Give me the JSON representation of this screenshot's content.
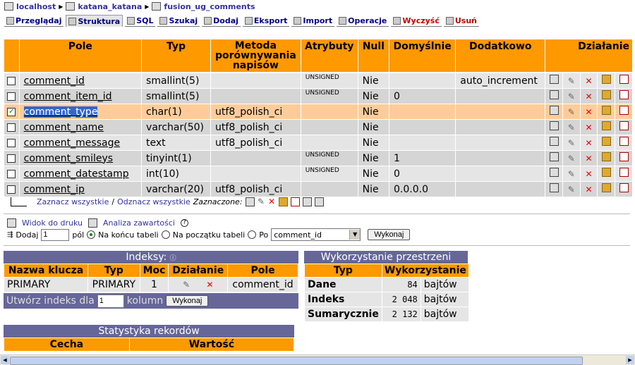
{
  "breadcrumb": {
    "server": "localhost",
    "database": "katana_katana",
    "table": "fusion_ug_comments"
  },
  "tabs": [
    {
      "label": "Przeglądaj",
      "icon": "browse-icon",
      "active": false
    },
    {
      "label": "Struktura",
      "icon": "structure-icon",
      "active": true
    },
    {
      "label": "SQL",
      "icon": "sql-icon",
      "active": false
    },
    {
      "label": "Szukaj",
      "icon": "search-icon",
      "active": false
    },
    {
      "label": "Dodaj",
      "icon": "insert-icon",
      "active": false
    },
    {
      "label": "Eksport",
      "icon": "export-icon",
      "active": false
    },
    {
      "label": "Import",
      "icon": "import-icon",
      "active": false
    },
    {
      "label": "Operacje",
      "icon": "operations-icon",
      "active": false
    },
    {
      "label": "Wyczyść",
      "icon": "empty-icon",
      "active": false
    },
    {
      "label": "Usuń",
      "icon": "drop-icon",
      "active": false
    }
  ],
  "structure": {
    "headers": {
      "pole": "Pole",
      "typ": "Typ",
      "metoda": "Metoda porównywania napisów",
      "atrybuty": "Atrybuty",
      "null": "Null",
      "domyslnie": "Domyślnie",
      "dodatkowo": "Dodatkowo",
      "dzialanie": "Działanie"
    },
    "rows": [
      {
        "name": "comment_id",
        "type": "smallint(5)",
        "collation": "",
        "attributes": "UNSIGNED",
        "null": "Nie",
        "default": "",
        "extra": "auto_increment",
        "checked": false
      },
      {
        "name": "comment_item_id",
        "type": "smallint(5)",
        "collation": "",
        "attributes": "UNSIGNED",
        "null": "Nie",
        "default": "0",
        "extra": "",
        "checked": false
      },
      {
        "name": "comment_type",
        "type": "char(1)",
        "collation": "utf8_polish_ci",
        "attributes": "",
        "null": "Nie",
        "default": "",
        "extra": "",
        "checked": true
      },
      {
        "name": "comment_name",
        "type": "varchar(50)",
        "collation": "utf8_polish_ci",
        "attributes": "",
        "null": "Nie",
        "default": "",
        "extra": "",
        "checked": false
      },
      {
        "name": "comment_message",
        "type": "text",
        "collation": "utf8_polish_ci",
        "attributes": "",
        "null": "Nie",
        "default": "",
        "extra": "",
        "checked": false
      },
      {
        "name": "comment_smileys",
        "type": "tinyint(1)",
        "collation": "",
        "attributes": "UNSIGNED",
        "null": "Nie",
        "default": "1",
        "extra": "",
        "checked": false
      },
      {
        "name": "comment_datestamp",
        "type": "int(10)",
        "collation": "",
        "attributes": "UNSIGNED",
        "null": "Nie",
        "default": "0",
        "extra": "",
        "checked": false
      },
      {
        "name": "comment_ip",
        "type": "varchar(20)",
        "collation": "utf8_polish_ci",
        "attributes": "",
        "null": "Nie",
        "default": "0.0.0.0",
        "extra": "",
        "checked": false
      }
    ]
  },
  "selection": {
    "check_all": "Zaznacz wszystkie",
    "slash": "/",
    "uncheck_all": "Odznacz wszystkie",
    "with_selected": "Zaznaczone:"
  },
  "links": {
    "print_view": "Widok do druku",
    "analyze": "Analiza zawartości"
  },
  "add_fields": {
    "label": "Dodaj",
    "count": "1",
    "fields": "pól",
    "at_end": "Na końcu tabeli",
    "at_beginning": "Na początku tabeli",
    "after": "Po",
    "after_field": "comment_id",
    "go": "Wykonaj"
  },
  "indexes": {
    "title": "Indeksy:",
    "headers": [
      "Nazwa klucza",
      "Typ",
      "Moc",
      "Działanie",
      "Pole"
    ],
    "row": {
      "name": "PRIMARY",
      "type": "PRIMARY",
      "cardinality": "1",
      "field": "comment_id"
    },
    "create_label": "Utwórz indeks dla",
    "create_count": "1",
    "create_columns": "kolumn",
    "create_go": "Wykonaj"
  },
  "space": {
    "title": "Wykorzystanie przestrzeni",
    "headers": [
      "Typ",
      "Wykorzystanie"
    ],
    "rows": [
      {
        "label": "Dane",
        "value": "84",
        "unit": "bajtów"
      },
      {
        "label": "Indeks",
        "value": "2 048",
        "unit": "bajtów"
      },
      {
        "label": "Sumarycznie",
        "value": "2 132",
        "unit": "bajtów"
      }
    ]
  },
  "stats": {
    "title": "Statystyka rekordów",
    "headers": [
      "Cecha",
      "Wartość"
    ]
  },
  "colors": {
    "header": "#ff9900",
    "panel": "#666699",
    "row": "#e5e5e5",
    "marked": "#ffcc99"
  }
}
